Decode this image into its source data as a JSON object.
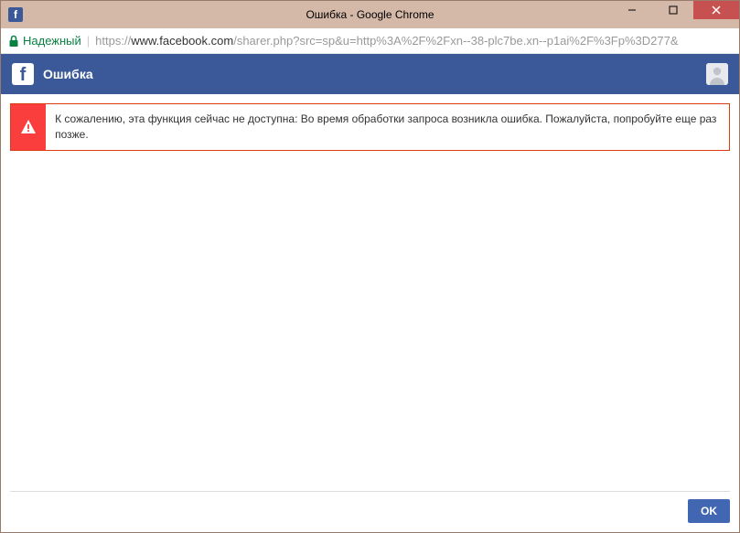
{
  "window": {
    "title": "Ошибка - Google Chrome"
  },
  "addressbar": {
    "secure_label": "Надежный",
    "url_prefix": "https://",
    "url_host": "www.facebook.com",
    "url_path": "/sharer.php?src=sp&u=http%3A%2F%2Fxn--38-plc7be.xn--p1ai%2F%3Fp%3D277&"
  },
  "fb_header": {
    "title": "Ошибка"
  },
  "error": {
    "message": "К сожалению, эта функция сейчас не доступна: Во время обработки запроса возникла ошибка. Пожалуйста, попробуйте еще раз позже."
  },
  "footer": {
    "ok_label": "OK"
  }
}
